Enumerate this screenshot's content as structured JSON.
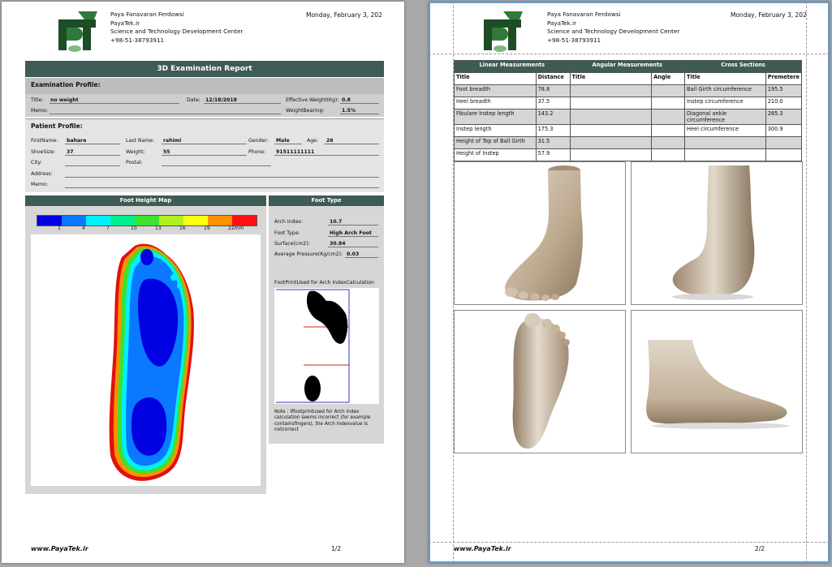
{
  "header": {
    "company": "Paya Fanavaran Ferdowsi",
    "site": "PayaTek.ir",
    "center": "Science and Technology Development Center",
    "phone": "+98-51-38793911",
    "date": "Monday, February 3, 202"
  },
  "report_title": "3D Examination Report",
  "exam_profile": {
    "heading": "Examination Profile:",
    "title_label": "Title:",
    "title_value": "no weight",
    "date_label": "Date:",
    "date_value": "12/18/2018",
    "eff_weight_label": "Effective Weight(Kg):",
    "eff_weight_value": "0.8",
    "memo_label": "Memo:",
    "weight_bearing_label": "WeightBearing:",
    "weight_bearing_value": "1.5%"
  },
  "patient": {
    "heading": "Patient Profile:",
    "first_label": "FirstName:",
    "first_value": "bahare",
    "last_label": "Last Name:",
    "last_value": "rahimi",
    "gender_label": "Gender:",
    "gender_value": "Male",
    "age_label": "Age:",
    "age_value": "26",
    "shoe_label": "ShoeSize:",
    "shoe_value": "37",
    "weight_label": "Weight:",
    "weight_value": "55",
    "phone_label": "Phone:",
    "phone_value": "91511111111",
    "city_label": "City:",
    "postal_label": "Postal:",
    "address_label": "Address:",
    "memo_label": "Memo:"
  },
  "height_map": {
    "title": "Foot Height Map",
    "scale_colors": [
      "#0000e0",
      "#0a78ff",
      "#00f0ff",
      "#00f090",
      "#40e030",
      "#b0f020",
      "#ffff10",
      "#ff9000",
      "#ff1010"
    ],
    "scale_labels": [
      "1",
      "4",
      "7",
      "10",
      "13",
      "16",
      "19",
      "22mm"
    ]
  },
  "foot_type": {
    "title": "Foot Type",
    "arch_index_label": "Arch Index:",
    "arch_index_value": "10.7",
    "foot_type_label": "Foot Type:",
    "foot_type_value": "High Arch Foot",
    "surface_label": "Surface(cm2):",
    "surface_value": "30.84",
    "pressure_label": "Average Pressure(Kg/cm2):",
    "pressure_value": "0.03",
    "footprint_label": "FootPrintUsed for Arch IndexCalculation",
    "note": "Note : Iffootprintused for Arch index calculation seems incorrect (for example containsfingers), the Arch Indexvalue is notcorrect"
  },
  "footer": {
    "site": "www.PayaTek.ir",
    "page1": "1/2",
    "page2": "2/2"
  },
  "measurements": {
    "group_headers": [
      "Linear Measurements",
      "Angular Measurements",
      "Cross Sections"
    ],
    "col_headers": [
      "Title",
      "Distance",
      "Title",
      "Angle",
      "Title",
      "Premetere"
    ],
    "rows": [
      {
        "l_title": "Foot breadth",
        "l_val": "78.8",
        "a_title": "",
        "a_val": "",
        "c_title": "Ball Girth circumference",
        "c_val": "195.5"
      },
      {
        "l_title": "Heel breadth",
        "l_val": "37.5",
        "a_title": "",
        "a_val": "",
        "c_title": "Instep circumference",
        "c_val": "210.0"
      },
      {
        "l_title": "Fibulare Instep length",
        "l_val": "143.2",
        "a_title": "",
        "a_val": "",
        "c_title": "Diagonal ankle circumference",
        "c_val": "285.3"
      },
      {
        "l_title": "Instep length",
        "l_val": "175.3",
        "a_title": "",
        "a_val": "",
        "c_title": "Heel circumference",
        "c_val": "300.9"
      },
      {
        "l_title": "Height of Top of Ball Girth",
        "l_val": "31.5",
        "a_title": "",
        "a_val": "",
        "c_title": "",
        "c_val": ""
      },
      {
        "l_title": "Height of Instep",
        "l_val": "57.9",
        "a_title": "",
        "a_val": "",
        "c_title": "",
        "c_val": ""
      }
    ]
  },
  "colors": {
    "header_bar": "#3e5b56",
    "panel_grey": "#d6d6d6",
    "foot_skin": "#c8b8a4"
  }
}
